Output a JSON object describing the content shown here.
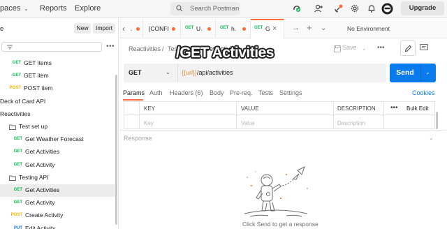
{
  "topnav": {
    "workspace_partial": "paces",
    "reports": "Reports",
    "explore": "Explore",
    "search_placeholder": "Search Postman",
    "upgrade": "Upgrade"
  },
  "sidebar": {
    "workspace_partial": "e",
    "new_label": "New",
    "import_label": "Import",
    "items": [
      {
        "kind": "request",
        "method": "GET",
        "label": "GET items"
      },
      {
        "kind": "request",
        "method": "GET",
        "label": "GET item"
      },
      {
        "kind": "request",
        "method": "POST",
        "label": "POST item"
      },
      {
        "kind": "collection",
        "label": "Deck of Card API"
      },
      {
        "kind": "collection",
        "label": "Reactivities"
      },
      {
        "kind": "folder",
        "label": "Test set up"
      },
      {
        "kind": "request",
        "method": "GET",
        "label": "Get Weather Forecast"
      },
      {
        "kind": "request",
        "method": "GET",
        "label": "Get Activities"
      },
      {
        "kind": "request",
        "method": "GET",
        "label": "Get Activity"
      },
      {
        "kind": "folder",
        "label": "Testing API"
      },
      {
        "kind": "request",
        "method": "GET",
        "label": "Get Activities",
        "active": true
      },
      {
        "kind": "request",
        "method": "GET",
        "label": "Get Activity"
      },
      {
        "kind": "request",
        "method": "POST",
        "label": "Create Activity"
      },
      {
        "kind": "request",
        "method": "PUT",
        "label": "Edit Activity"
      }
    ]
  },
  "tabs": {
    "items": [
      {
        "method": "",
        "label": "."
      },
      {
        "method": "",
        "label": "[CONFI"
      },
      {
        "method": "GET",
        "label": "U."
      },
      {
        "method": "GET",
        "label": "h."
      },
      {
        "method": "GET",
        "label": "G"
      }
    ],
    "environment": "No Environment"
  },
  "breadcrumb": {
    "collection": "Reactivities",
    "folder": "Testing API",
    "current": "Get Activities",
    "sep": "/"
  },
  "overlay_title": "/GET Activities",
  "header": {
    "save_label": "Save"
  },
  "request": {
    "method": "GET",
    "url_variable": "{{url}}",
    "url_path": "/api/activities",
    "send_label": "Send"
  },
  "request_tabs": [
    {
      "label": "Params",
      "active": true
    },
    {
      "label": "Auth"
    },
    {
      "label": "Headers (6)"
    },
    {
      "label": "Body"
    },
    {
      "label": "Pre-req."
    },
    {
      "label": "Tests"
    },
    {
      "label": "Settings"
    }
  ],
  "cookies_label": "Cookies",
  "params": {
    "headers": [
      "KEY",
      "VALUE",
      "DESCRIPTION"
    ],
    "placeholders": [
      "Key",
      "Value",
      "Description"
    ],
    "bulk_edit": "Bulk Edit"
  },
  "response": {
    "label": "Response",
    "hint": "Click Send to get a response"
  },
  "colors": {
    "accent": "#ff6c37",
    "send": "#097bed",
    "get": "#0cbb52",
    "post": "#ffb400",
    "put": "#097bed"
  }
}
